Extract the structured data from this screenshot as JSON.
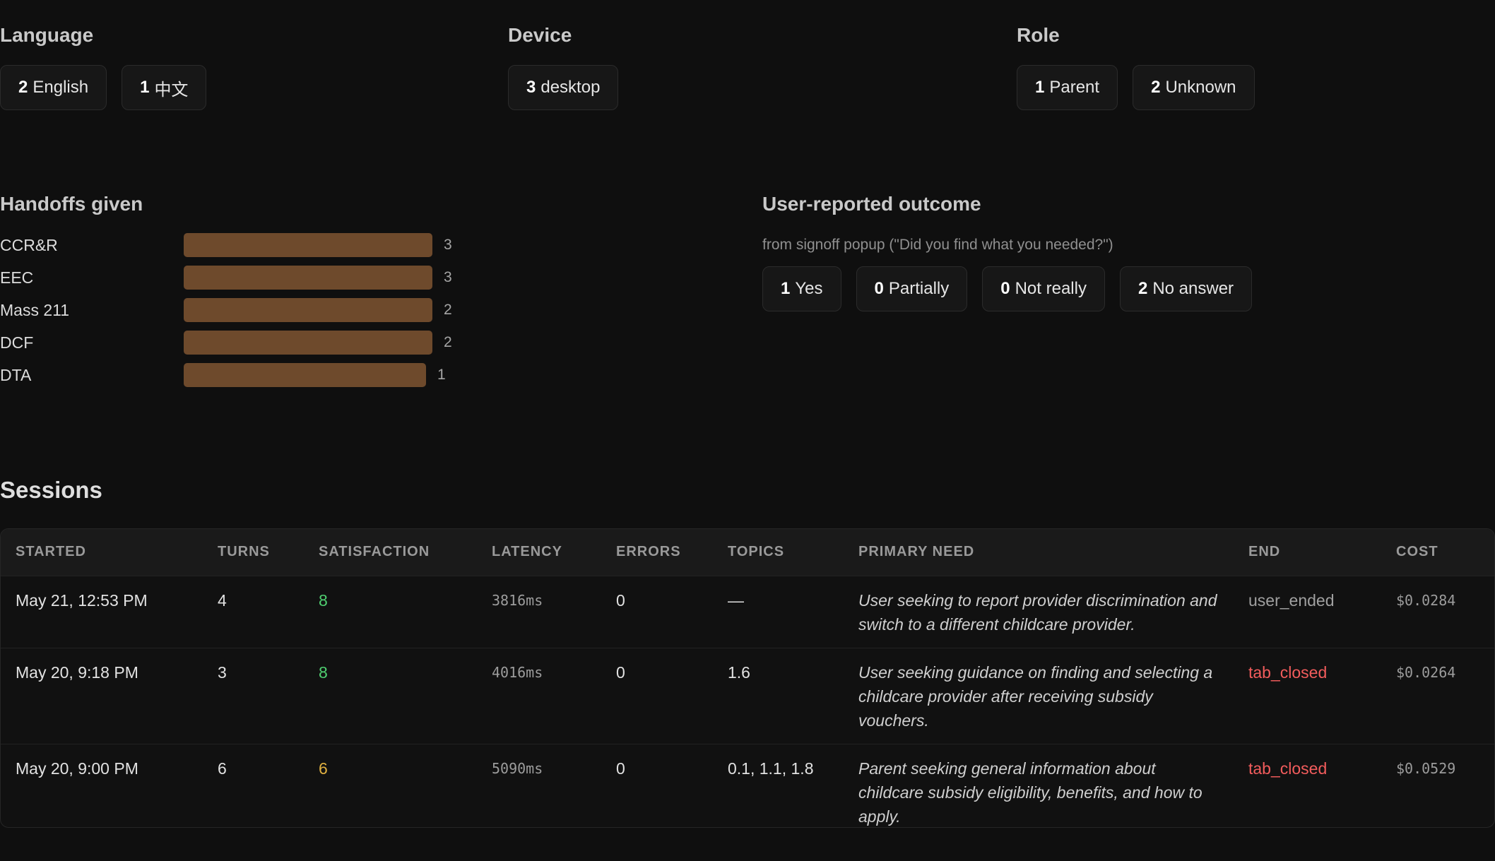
{
  "language": {
    "title": "Language",
    "chips": [
      {
        "count": "2",
        "label": "English"
      },
      {
        "count": "1",
        "label": "中文"
      }
    ]
  },
  "device": {
    "title": "Device",
    "chips": [
      {
        "count": "3",
        "label": "desktop"
      }
    ]
  },
  "role": {
    "title": "Role",
    "chips": [
      {
        "count": "1",
        "label": "Parent"
      },
      {
        "count": "2",
        "label": "Unknown"
      }
    ]
  },
  "handoffs": {
    "title": "Handoffs given",
    "items": [
      {
        "label": "CCR&R",
        "value": 3
      },
      {
        "label": "EEC",
        "value": 3
      },
      {
        "label": "Mass 211",
        "value": 2
      },
      {
        "label": "DCF",
        "value": 2
      },
      {
        "label": "DTA",
        "value": 1
      }
    ]
  },
  "outcome": {
    "title": "User-reported outcome",
    "subtitle": "from signoff popup (\"Did you find what you needed?\")",
    "chips": [
      {
        "count": "1",
        "label": "Yes"
      },
      {
        "count": "0",
        "label": "Partially"
      },
      {
        "count": "0",
        "label": "Not really"
      },
      {
        "count": "2",
        "label": "No answer"
      }
    ]
  },
  "sessions": {
    "title": "Sessions",
    "columns": [
      "STARTED",
      "TURNS",
      "SATISFACTION",
      "LATENCY",
      "ERRORS",
      "TOPICS",
      "PRIMARY NEED",
      "END",
      "COST"
    ],
    "rows": [
      {
        "started": "May 21, 12:53 PM",
        "turns": "4",
        "satisfaction": "8",
        "satisfaction_color": "#4fcf70",
        "latency": "3816ms",
        "errors": "0",
        "topics": "—",
        "need": "User seeking to report provider discrimination and switch to a different childcare provider.",
        "end": "user_ended",
        "end_color": "#a0a0a0",
        "cost": "$0.0284"
      },
      {
        "started": "May 20, 9:18 PM",
        "turns": "3",
        "satisfaction": "8",
        "satisfaction_color": "#4fcf70",
        "latency": "4016ms",
        "errors": "0",
        "topics": "1.6",
        "need": "User seeking guidance on finding and selecting a childcare provider after receiving subsidy vouchers.",
        "end": "tab_closed",
        "end_color": "#f25c5c",
        "cost": "$0.0264"
      },
      {
        "started": "May 20, 9:00 PM",
        "turns": "6",
        "satisfaction": "6",
        "satisfaction_color": "#e0b040",
        "latency": "5090ms",
        "errors": "0",
        "topics": "0.1, 1.1, 1.8",
        "need": "Parent seeking general information about childcare subsidy eligibility, benefits, and how to apply.",
        "end": "tab_closed",
        "end_color": "#f25c5c",
        "cost": "$0.0529"
      }
    ]
  }
}
